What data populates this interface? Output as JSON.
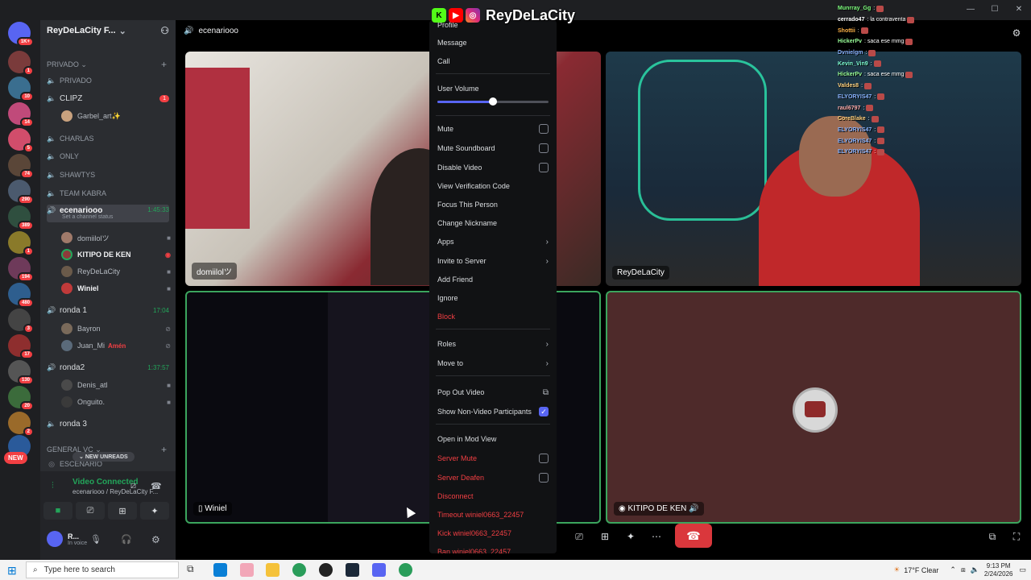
{
  "window": {
    "minimize": "—",
    "maximize": "☐",
    "close": "✕"
  },
  "server": {
    "name": "ReyDeLaCity F...",
    "new_pill": "NEW",
    "new_unreads": "NEW UNREADS"
  },
  "rail_badges": [
    "1K+",
    "1",
    "10",
    "14",
    "5",
    "74",
    "290",
    "389",
    "1",
    "194",
    "480",
    "3",
    "17",
    "130",
    "20",
    "2"
  ],
  "categories": {
    "privado": "PRIVADO",
    "general": "GENERAL VC"
  },
  "channels": {
    "privado": "PRIVADO",
    "clipz": "CLIPZ",
    "clipz_badge": "1",
    "clipz_user": "Garbel_art✨",
    "charlas": "CHARLAS",
    "only": "ONLY",
    "shawtys": "SHAWTYS",
    "team_kabra": "TEAM KABRA",
    "ecenario": "ecenariooo",
    "ecenario_time": "1:45:33",
    "ecenario_status": "Set a channel status",
    "ronda1": "ronda 1",
    "ronda1_time": "17:04",
    "ronda2": "ronda2",
    "ronda2_time": "1:37:57",
    "ronda3": "ronda 3",
    "escenario": "ESCENARIO"
  },
  "voice_users": {
    "u1": "domiilolツ",
    "u2": "KITIPO DE KEN",
    "u3": "ReyDeLaCity",
    "u4": "Winiel",
    "r1a": "Bayron",
    "r1b": "Juan_Mi",
    "r1b_tag": "Amén",
    "r2a": "Denis_atl",
    "r2b": "Onguito."
  },
  "voice_panel": {
    "status": "Video Connected",
    "channel": "ecenariooo / ReyDeLaCity F...",
    "user": "R...",
    "user_status": "In voice"
  },
  "main": {
    "channel_title": "ecenariooo",
    "tiles": [
      "domiilolツ",
      "ReyDeLaCity",
      "Winiel",
      "KITIPO DE KEN"
    ]
  },
  "context_menu": {
    "profile": "Profile",
    "message": "Message",
    "call": "Call",
    "user_volume": "User Volume",
    "volume_level": 0.5,
    "mute": "Mute",
    "mute_soundboard": "Mute Soundboard",
    "disable_video": "Disable Video",
    "view_verification": "View Verification Code",
    "focus": "Focus This Person",
    "change_nickname": "Change Nickname",
    "apps": "Apps",
    "invite": "Invite to Server",
    "add_friend": "Add Friend",
    "ignore": "Ignore",
    "block": "Block",
    "roles": "Roles",
    "move_to": "Move to",
    "pop_out": "Pop Out Video",
    "show_non_video": "Show Non-Video Participants",
    "mod_view": "Open in Mod View",
    "server_mute": "Server Mute",
    "server_deafen": "Server Deafen",
    "disconnect": "Disconnect",
    "timeout": "Timeout winiel0663_22457",
    "kick": "Kick winiel0663_22457",
    "ban": "Ban winiel0663_22457"
  },
  "overlay": {
    "brand": "ReyDeLaCity"
  },
  "chat": [
    {
      "user": "Munrray_Gg",
      "msg": ":",
      "color": "#7fff7f"
    },
    {
      "user": "cerrado47",
      "msg": ": la contraventa",
      "color": "#ffffff"
    },
    {
      "user": "Shottii",
      "msg": ":",
      "color": "#ffb347"
    },
    {
      "user": "HickerPv",
      "msg": ": saca ese mmg",
      "color": "#9aff9a"
    },
    {
      "user": "Dvnielgm",
      "msg": ":",
      "color": "#8ab4ff"
    },
    {
      "user": "Kevin_Vin9",
      "msg": ":",
      "color": "#7fffd4"
    },
    {
      "user": "HickerPv",
      "msg": ": saca ese mmg",
      "color": "#9aff9a"
    },
    {
      "user": "Valdes8",
      "msg": ":",
      "color": "#ffd27f"
    },
    {
      "user": "ELYORYIS47",
      "msg": ":",
      "color": "#8ab4ff"
    },
    {
      "user": "raul6797",
      "msg": ":",
      "color": "#ffb0b0"
    },
    {
      "user": "CoreBlake",
      "msg": ":",
      "color": "#ffd27f"
    },
    {
      "user": "ELYORYIS47",
      "msg": ":",
      "color": "#8ab4ff"
    },
    {
      "user": "ELYORYIS47",
      "msg": ":",
      "color": "#8ab4ff"
    },
    {
      "user": "ELYORYIS47",
      "msg": ":",
      "color": "#8ab4ff"
    }
  ],
  "taskbar": {
    "search_placeholder": "Type here to search",
    "weather": "17°F  Clear",
    "time": "9:13 PM",
    "date": "2/24/2026"
  },
  "colors": {
    "accent": "#5865f2",
    "online": "#23a55a",
    "danger": "#f23f43"
  }
}
